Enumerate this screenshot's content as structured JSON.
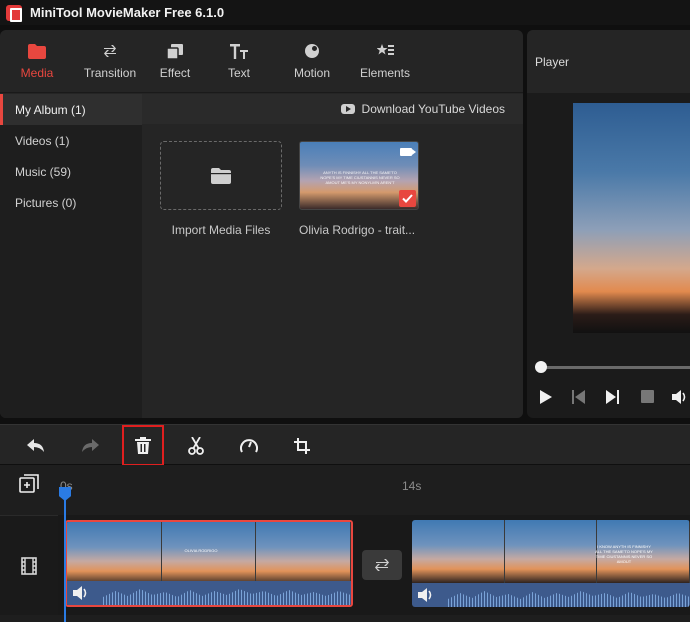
{
  "app": {
    "title": "MiniTool MovieMaker Free 6.1.0",
    "accent_color": "#e8473f"
  },
  "tabs": [
    {
      "label": "Media",
      "icon": "folder-icon",
      "active": true
    },
    {
      "label": "Transition",
      "icon": "swap-arrows-icon",
      "active": false
    },
    {
      "label": "Effect",
      "icon": "layers-icon",
      "active": false
    },
    {
      "label": "Text",
      "icon": "text-icon",
      "active": false
    },
    {
      "label": "Motion",
      "icon": "motion-icon",
      "active": false
    },
    {
      "label": "Elements",
      "icon": "elements-icon",
      "active": false
    }
  ],
  "sidebar": {
    "items": [
      {
        "label": "My Album (1)",
        "active": true
      },
      {
        "label": "Videos (1)",
        "active": false
      },
      {
        "label": "Music (59)",
        "active": false
      },
      {
        "label": "Pictures (0)",
        "active": false
      }
    ]
  },
  "media": {
    "download_label": "Download YouTube Videos",
    "import_label": "Import Media Files",
    "clip_label": "Olivia Rodrigo - trait...",
    "thumb_caption": "ANYTH IS FINNISHY ALL THE  SAME'TO NOPE'S MY TIME CIUSTANNIS NEVER SO AMOUT ME'S MY NONYLM'N AREN'T"
  },
  "player": {
    "header": "Player"
  },
  "toolbar": {
    "tools": [
      "undo-icon",
      "redo-icon",
      "delete-icon",
      "split-icon",
      "speed-icon",
      "crop-icon"
    ],
    "highlighted_tool": "delete-icon",
    "highlight_color": "#e01f1f"
  },
  "timeline": {
    "time_start": "0s",
    "time_mark": "14s",
    "playhead_color": "#2a7be4",
    "clip1_caption": "OLIVIA RODRIGO",
    "clip2_caption": "I KNOW ANYTH IS FINNISHY ALL THE SAME'TO NOPE'S MY TIME CIUSTANNIS NEVER SO AMOUT"
  }
}
